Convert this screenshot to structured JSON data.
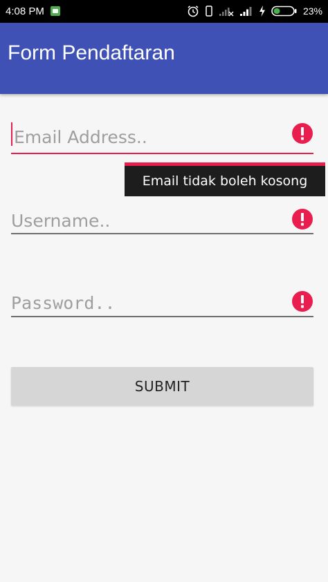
{
  "status_bar": {
    "time": "4:08 PM",
    "battery_percent": "23%"
  },
  "app_bar": {
    "title": "Form Pendaftaran"
  },
  "form": {
    "email": {
      "placeholder": "Email Address..",
      "value": "",
      "error_icon": "error-icon",
      "error_message": "Email tidak boleh kosong"
    },
    "username": {
      "placeholder": "Username..",
      "value": "",
      "error_icon": "error-icon"
    },
    "password": {
      "placeholder": "Password..",
      "value": "",
      "error_icon": "error-icon"
    },
    "submit_label": "SUBMIT"
  },
  "colors": {
    "app_bar": "#3f51b5",
    "error": "#e91e4f",
    "status_bar": "#000000",
    "background": "#f6f6f6",
    "button": "#d6d6d6"
  }
}
